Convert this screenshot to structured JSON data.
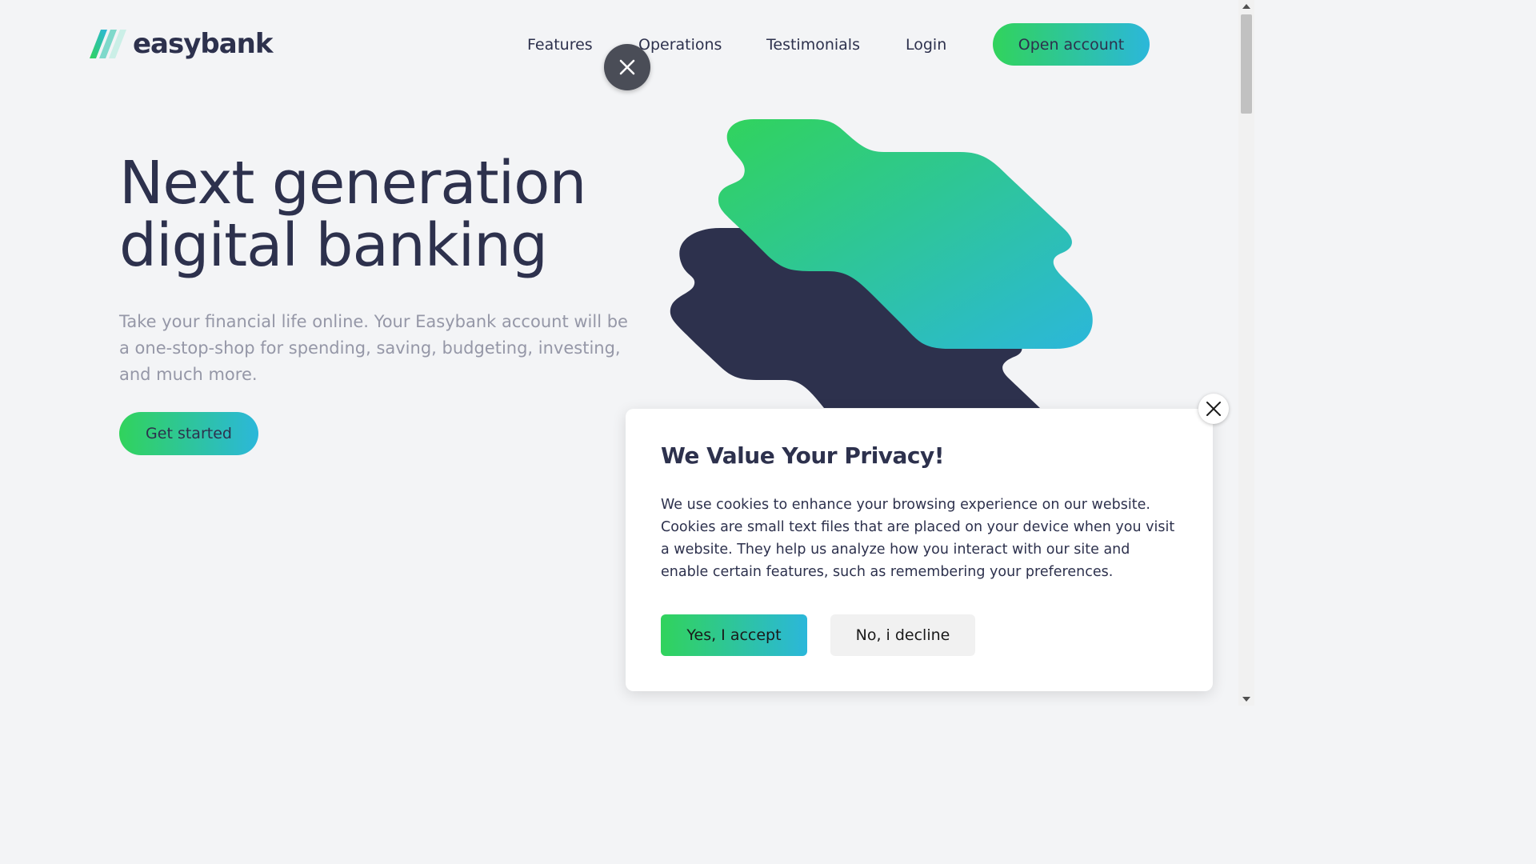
{
  "brand": {
    "name": "easybank"
  },
  "nav": {
    "items": [
      "Features",
      "Operations",
      "Testimonials",
      "Login"
    ],
    "cta": "Open account"
  },
  "hero": {
    "title_line1": "Next generation",
    "title_line2": "digital banking",
    "text": "Take your financial life online. Your Easybank account will be a one-stop-shop for spending, saving, budgeting, investing, and much more.",
    "cta": "Get started"
  },
  "cookie": {
    "title": "We Value Your Privacy!",
    "body": "We use cookies to enhance your browsing experience on our website. Cookies are small text files that are placed on your device when you visit a website. They help us analyze how you interact with our site and enable certain features, such as remembering your preferences.",
    "accept": "Yes, I accept",
    "decline": "No, i decline"
  },
  "icons": [
    "logo-mark-icon",
    "close-icon",
    "scroll-up-arrow-icon",
    "scroll-down-arrow-icon"
  ],
  "colors": {
    "dark_blue": "#2d314d",
    "grayish_blue": "#9597a7",
    "light_gray_bg": "#f3f4f6",
    "lime_green": "#31d35c",
    "bright_cyan": "#2bb7da",
    "white": "#ffffff"
  }
}
